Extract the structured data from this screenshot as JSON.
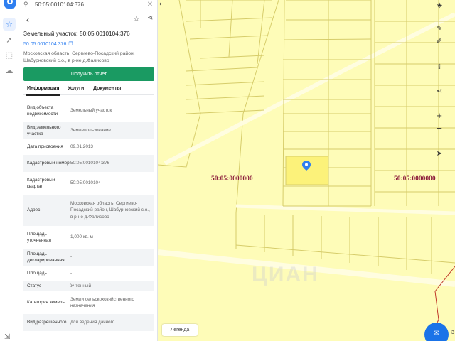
{
  "search": {
    "value": "50:05:0010104:376",
    "close": "✕"
  },
  "panel": {
    "title": "Земельный участок: 50:05:0010104:376",
    "cad_link": "50:05:0010104:376",
    "address": "Московская область, Сергиево-Посадский район, Шабурновский с.о., в р-не д.Фалисово",
    "report_button": "Получить отчет",
    "tabs": [
      "Информация",
      "Услуги",
      "Документы"
    ],
    "rows": [
      {
        "k": "Вид объекта недвижимости",
        "v": "Земельный участок"
      },
      {
        "k": "Вид земельного участка",
        "v": "Землепользование"
      },
      {
        "k": "Дата присвоения",
        "v": "09.01.2013"
      },
      {
        "k": "Кадастровый номер",
        "v": "50:05:0010104:376"
      },
      {
        "k": "Кадастровый квартал",
        "v": "50:05:0010104"
      },
      {
        "k": "Адрес",
        "v": "Московская область, Сергиево-Посадский район, Шабурновский с.о., в р-не д.Фалисово"
      },
      {
        "k": "Площадь уточненная",
        "v": "1,000 кв. м"
      },
      {
        "k": "Площадь декларированная",
        "v": "-"
      },
      {
        "k": "Площадь",
        "v": "-"
      },
      {
        "k": "Статус",
        "v": "Учтенный"
      },
      {
        "k": "Категория земель",
        "v": "Земли сельскохозяйственного назначения"
      },
      {
        "k": "Вид разрешенного",
        "v": "для ведения дачного"
      }
    ]
  },
  "map": {
    "label_left": "50:05:0000000",
    "label_right": "50:05:0000000",
    "watermark": "ЦИАН",
    "legend": "Легенда",
    "corner_number": "3"
  },
  "icons": {
    "search": "search-icon",
    "back": "back-icon",
    "star": "star-icon",
    "share": "share-icon",
    "copy": "copy-icon",
    "layers": "layers-icon",
    "ruler": "ruler-icon",
    "edit": "edit-icon",
    "upload": "upload-icon",
    "zoom_in": "zoom-in-icon",
    "zoom_out": "zoom-out-icon",
    "locate": "locate-icon",
    "mail": "mail-icon"
  },
  "colors": {
    "accent": "#2f7ff0",
    "button": "#1a9a62",
    "map_fill": "#fefcb8",
    "label": "#8b1a3a"
  }
}
